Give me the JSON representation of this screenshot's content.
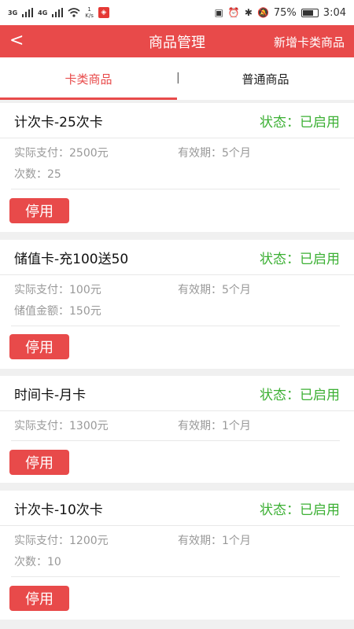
{
  "status_bar": {
    "signal1": "3G",
    "signal2": "4G",
    "net_speed_value": "1",
    "net_speed_unit": "K/s",
    "battery_pct": "75%",
    "battery_level": 0.75,
    "time": "3:04"
  },
  "navbar": {
    "back": "<",
    "title": "商品管理",
    "action": "新增卡类商品"
  },
  "tabs": [
    {
      "label": "卡类商品",
      "active": true
    },
    {
      "label": "普通商品",
      "active": false
    }
  ],
  "tab_separator": "|",
  "cards": [
    {
      "name": "计次卡-25次卡",
      "status": "状态：已启用",
      "paid": "实际支付：2500元",
      "validity": "有效期：5个月",
      "extra": "次数：25",
      "button": "停用"
    },
    {
      "name": "储值卡-充100送50",
      "status": "状态：已启用",
      "paid": "实际支付：100元",
      "validity": "有效期：5个月",
      "extra": "储值金额：150元",
      "button": "停用"
    },
    {
      "name": "时间卡-月卡",
      "status": "状态：已启用",
      "paid": "实际支付：1300元",
      "validity": "有效期：1个月",
      "button": "停用"
    },
    {
      "name": "计次卡-10次卡",
      "status": "状态：已启用",
      "paid": "实际支付：1200元",
      "validity": "有效期：1个月",
      "extra": "次数：10",
      "button": "停用"
    }
  ]
}
